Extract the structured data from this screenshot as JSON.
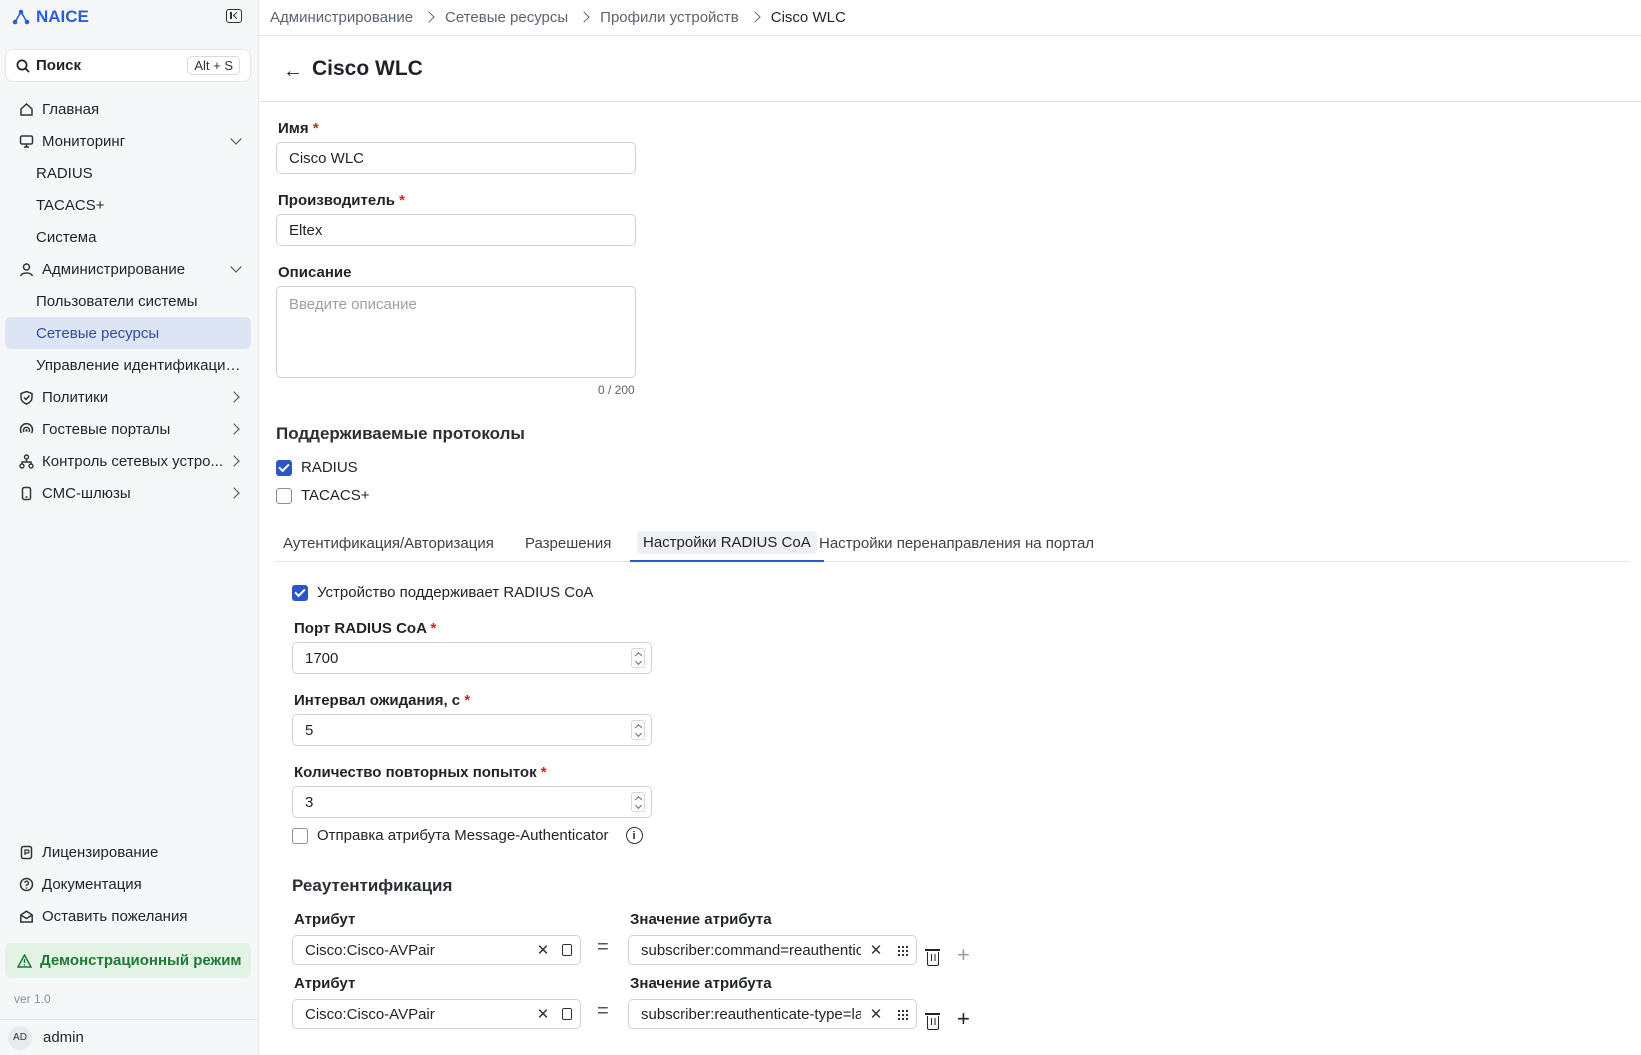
{
  "app": {
    "name": "NAICE"
  },
  "search": {
    "label": "Поиск",
    "shortcut": "Alt + S"
  },
  "sidebar": {
    "items": [
      {
        "label": "Главная"
      },
      {
        "label": "Мониторинг"
      },
      {
        "label": "RADIUS"
      },
      {
        "label": "TACACS+"
      },
      {
        "label": "Система"
      },
      {
        "label": "Администрирование"
      },
      {
        "label": "Пользователи системы"
      },
      {
        "label": "Сетевые ресурсы"
      },
      {
        "label": "Управление идентификацией"
      },
      {
        "label": "Политики"
      },
      {
        "label": "Гостевые порталы"
      },
      {
        "label": "Контроль сетевых устро..."
      },
      {
        "label": "СМС-шлюзы"
      }
    ],
    "bottom": [
      {
        "label": "Лицензирование"
      },
      {
        "label": "Документация"
      },
      {
        "label": "Оставить пожелания"
      }
    ],
    "demo_mode": "Демонстрационный режим",
    "version": "ver 1.0",
    "user": {
      "initials": "AD",
      "name": "admin"
    }
  },
  "breadcrumb": [
    "Администрирование",
    "Сетевые ресурсы",
    "Профили устройств",
    "Cisco WLC"
  ],
  "page": {
    "title": "Cisco WLC"
  },
  "form": {
    "name_label": "Имя",
    "name_value": "Cisco WLC",
    "vendor_label": "Производитель",
    "vendor_value": "Eltex",
    "description_label": "Описание",
    "description_placeholder": "Введите описание",
    "description_counter": "0 / 200",
    "protocols_title": "Поддерживаемые протоколы",
    "protocol_radius": "RADIUS",
    "protocol_tacacs": "TACACS+",
    "radius_checked": true,
    "tacacs_checked": false
  },
  "tabs": [
    {
      "label": "Аутентификация/Авторизация"
    },
    {
      "label": "Разрешения"
    },
    {
      "label": "Настройки RADIUS CoA"
    },
    {
      "label": "Настройки перенаправления на портал"
    }
  ],
  "active_tab": "Настройки RADIUS CoA",
  "coa": {
    "supports_label": "Устройство поддерживает RADIUS CoA",
    "supports_checked": true,
    "port_label": "Порт RADIUS CoA",
    "port_value": "1700",
    "timeout_label": "Интервал ожидания, с",
    "timeout_value": "5",
    "retries_label": "Количество повторных попыток",
    "retries_value": "3",
    "message_auth_label": "Отправка атрибута Message-Authenticator",
    "message_auth_checked": false
  },
  "reauth": {
    "title": "Реаутентификация",
    "rows": [
      {
        "attr_label": "Атрибут",
        "attr_value": "Cisco:Cisco-AVPair",
        "val_label": "Значение атрибута",
        "val_value": "subscriber:command=reauthenticate"
      },
      {
        "attr_label": "Атрибут",
        "attr_value": "Cisco:Cisco-AVPair",
        "val_label": "Значение атрибута",
        "val_value": "subscriber:reauthenticate-type=last"
      }
    ]
  },
  "colors": {
    "accent": "#2c56c8",
    "brand": "#2b5fd9",
    "active_nav": "#dde4f3",
    "demo_bg": "#e3f4e6",
    "demo_fg": "#1d7a35",
    "required": "#c62828"
  }
}
